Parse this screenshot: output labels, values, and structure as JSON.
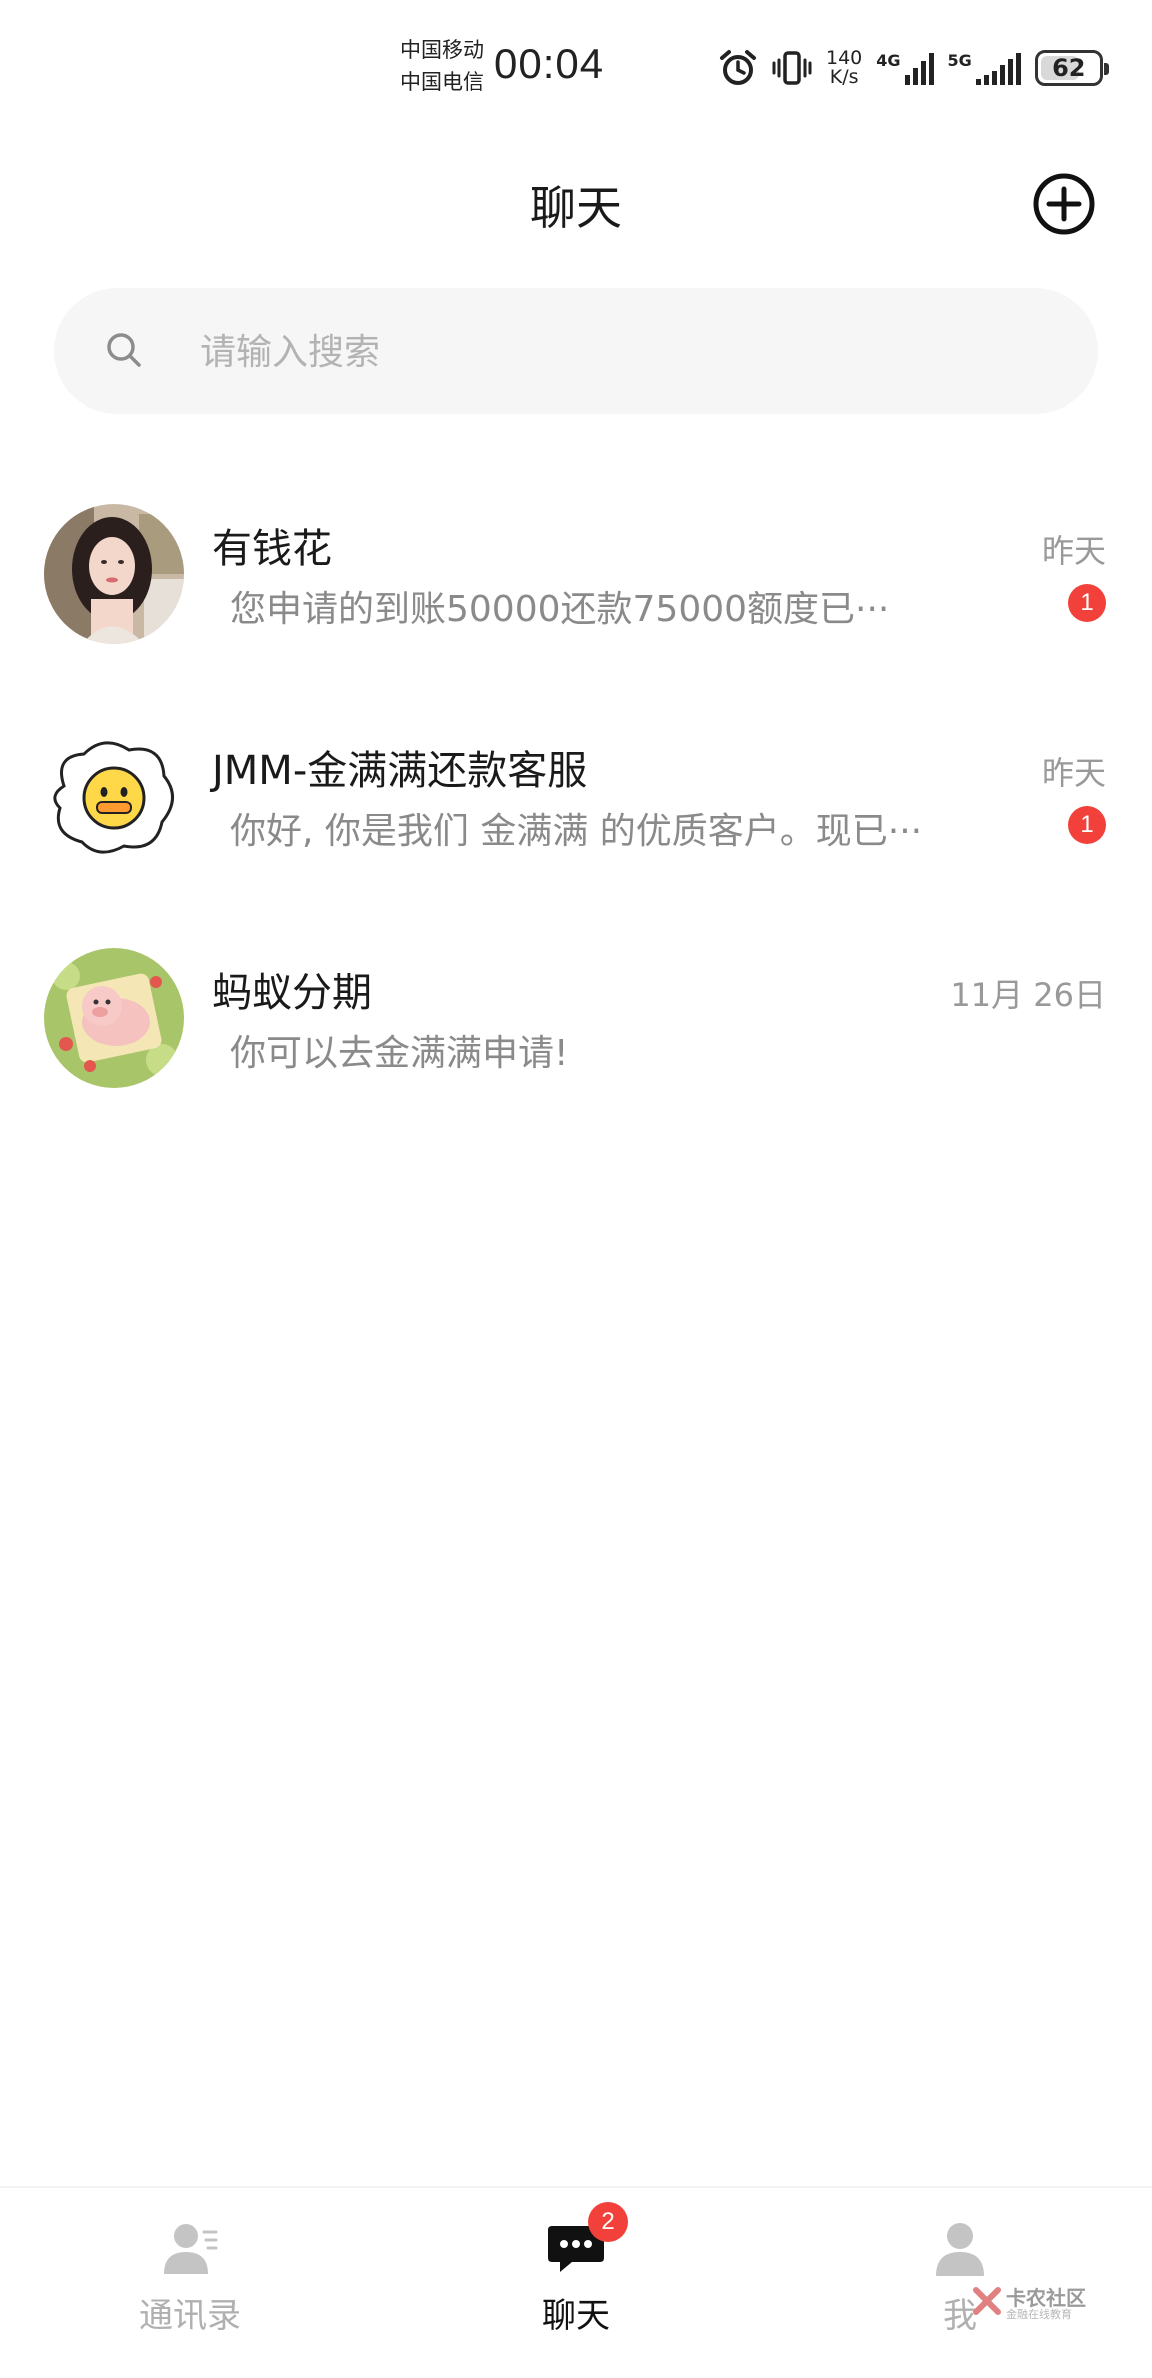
{
  "status_bar": {
    "carrier1": "中国移动",
    "carrier2": "中国电信",
    "time": "00:04",
    "speed_value": "140",
    "speed_unit": "K/s",
    "net1": "4G",
    "net2": "5G",
    "battery": "62",
    "icons": [
      "alarm-icon",
      "vibrate-icon",
      "signal-icon",
      "battery-icon"
    ]
  },
  "header": {
    "title": "聊天",
    "add_icon": "add-circle-icon"
  },
  "search": {
    "placeholder": "请输入搜索",
    "value": ""
  },
  "chats": [
    {
      "name": "有钱花",
      "preview": "您申请的到账50000还款75000额度已···",
      "time": "昨天",
      "unread": "1"
    },
    {
      "name": "JMM-金满满还款客服",
      "preview": "你好, 你是我们 金满满 的优质客户。现已···",
      "time": "昨天",
      "unread": "1"
    },
    {
      "name": "蚂蚁分期",
      "preview": "你可以去金满满申请!",
      "time": "11月 26日",
      "unread": ""
    }
  ],
  "bottom_nav": {
    "items": [
      {
        "label": "通讯录",
        "icon": "contacts-icon",
        "active": false
      },
      {
        "label": "聊天",
        "icon": "chat-bubble-icon",
        "active": true,
        "badge": "2"
      },
      {
        "label": "我",
        "icon": "user-icon",
        "active": false
      }
    ]
  },
  "watermark": {
    "line1": "卡农社区",
    "line2": "金融在线教育"
  },
  "colors": {
    "badge": "#f2413a",
    "inactive_nav": "#b0b0b0",
    "active_nav": "#111111",
    "search_bg": "#f6f6f6"
  }
}
